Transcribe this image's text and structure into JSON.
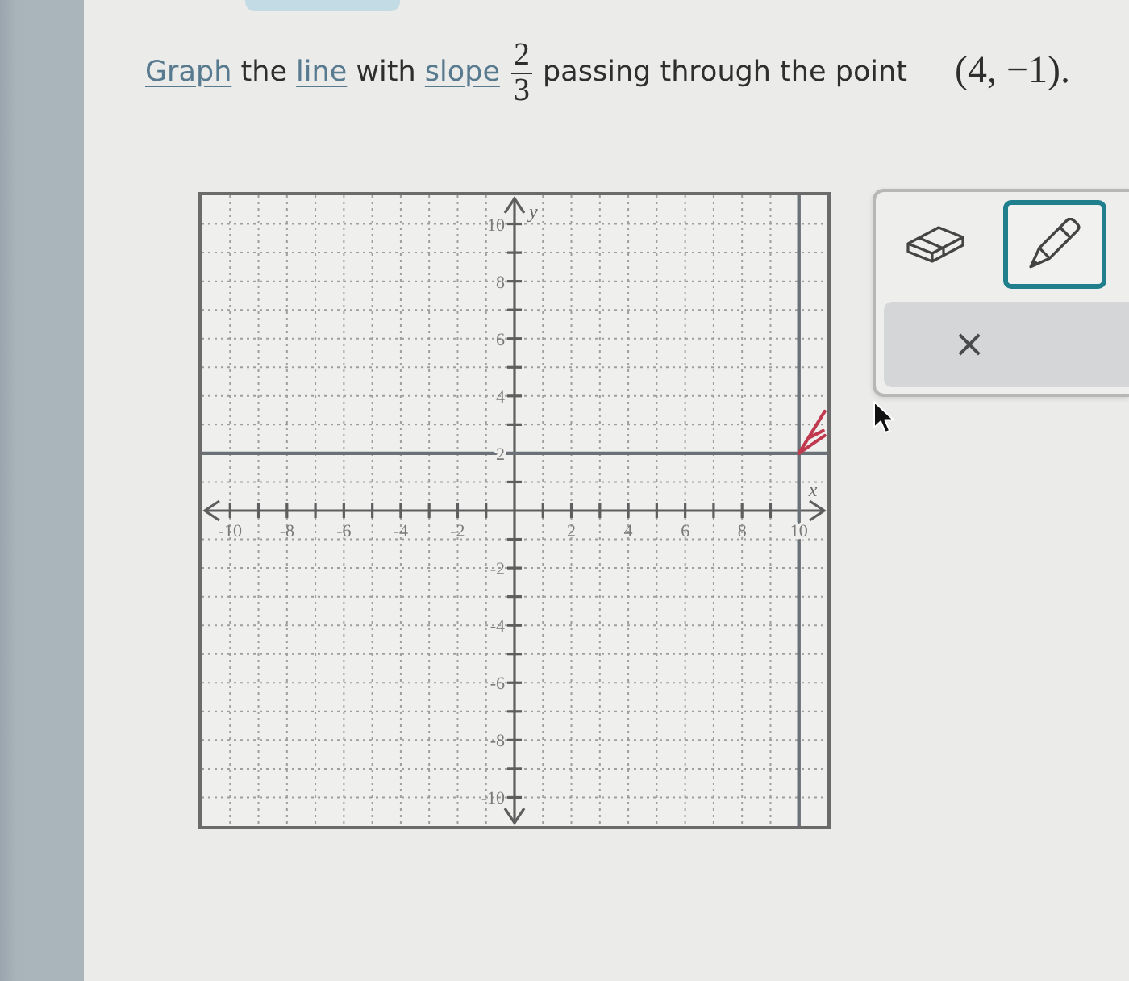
{
  "question": {
    "parts": [
      {
        "kind": "link",
        "text": "Graph"
      },
      {
        "kind": "text",
        "text": " the "
      },
      {
        "kind": "link",
        "text": "line"
      },
      {
        "kind": "text",
        "text": " with "
      },
      {
        "kind": "link",
        "text": "slope"
      },
      {
        "kind": "fraction",
        "numerator": "2",
        "denominator": "3"
      },
      {
        "kind": "text",
        "text": " passing through the point "
      },
      {
        "kind": "math",
        "text": "(4, −1)."
      }
    ]
  },
  "graph": {
    "chart_data": {
      "type": "line",
      "xlabel": "x",
      "ylabel": "y",
      "xlim": [
        -11,
        11
      ],
      "ylim": [
        -11,
        11
      ],
      "xticks": [
        -10,
        -8,
        -6,
        -4,
        -2,
        2,
        4,
        6,
        8,
        10
      ],
      "yticks": [
        -10,
        -8,
        -6,
        -4,
        -2,
        2,
        4,
        6,
        8,
        10
      ],
      "grid": true,
      "series": [
        {
          "color": "#6b7277",
          "x": [
            -11,
            11
          ],
          "values": [
            2,
            2
          ]
        },
        {
          "color": "#6b7277",
          "x": [
            10,
            10
          ],
          "values": [
            -11,
            11
          ]
        }
      ]
    }
  },
  "tools": [
    {
      "kind": "eraser",
      "selected": false
    },
    {
      "kind": "pencil",
      "selected": true
    }
  ],
  "clear_button": {
    "label": "×"
  }
}
